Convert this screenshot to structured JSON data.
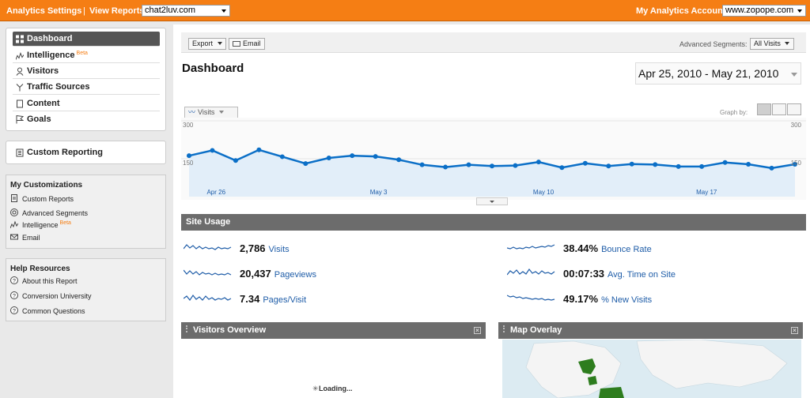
{
  "topbar": {
    "settings_link": "Analytics Settings",
    "view_reports_label": "View Reports:",
    "view_reports_value": "chat2luv.com",
    "accounts_label": "My Analytics Accounts:",
    "accounts_value": "www.zopope.com"
  },
  "nav": {
    "items": [
      {
        "label": "Dashboard",
        "icon": "dashboard-icon"
      },
      {
        "label": "Intelligence",
        "beta": "Beta",
        "icon": "intelligence-icon"
      },
      {
        "label": "Visitors",
        "icon": "person-icon"
      },
      {
        "label": "Traffic Sources",
        "icon": "traffic-icon"
      },
      {
        "label": "Content",
        "icon": "page-icon"
      },
      {
        "label": "Goals",
        "icon": "flag-icon"
      }
    ],
    "custom_reporting": "Custom Reporting"
  },
  "customizations": {
    "title": "My Customizations",
    "items": [
      {
        "label": "Custom Reports",
        "icon": "report-icon"
      },
      {
        "label": "Advanced Segments",
        "icon": "segments-icon"
      },
      {
        "label": "Intelligence",
        "beta": "Beta",
        "icon": "intelligence-icon"
      },
      {
        "label": "Email",
        "icon": "email-icon"
      }
    ]
  },
  "help": {
    "title": "Help Resources",
    "items": [
      {
        "label": "About this Report",
        "icon": "help-icon"
      },
      {
        "label": "Conversion University",
        "icon": "help-icon"
      },
      {
        "label": "Common Questions",
        "icon": "help-icon"
      }
    ]
  },
  "toolbar": {
    "export_label": "Export",
    "email_label": "Email",
    "segments_label": "Advanced Segments:",
    "segments_value": "All Visits"
  },
  "main": {
    "title": "Dashboard",
    "date_range": "Apr 25, 2010 - May 21, 2010",
    "metric_tab": "Visits",
    "graph_by_label": "Graph by:"
  },
  "chart_data": {
    "type": "area",
    "series": [
      {
        "values": [
          162,
          183,
          143,
          185,
          158,
          131,
          153,
          162,
          159,
          146,
          126,
          117,
          126,
          121,
          123,
          137,
          115,
          132,
          121,
          129,
          127,
          119,
          119,
          135,
          128,
          113,
          128
        ]
      }
    ],
    "ylim": [
      0,
      300
    ],
    "y_ticks_left": [
      "300",
      "150"
    ],
    "y_ticks_right": [
      "300",
      "150"
    ],
    "x_tick_labels": [
      "Apr 26",
      "May 3",
      "May 10",
      "May 17"
    ],
    "x_tick_index": [
      1,
      8,
      15,
      22
    ],
    "color": "#0b6fc7",
    "fill": "#e2eef9"
  },
  "site_usage": {
    "title": "Site Usage",
    "metrics": [
      {
        "value": "2,786",
        "label": "Visits"
      },
      {
        "value": "20,437",
        "label": "Pageviews"
      },
      {
        "value": "7.34",
        "label": "Pages/Visit"
      },
      {
        "value": "38.44%",
        "label": "Bounce Rate"
      },
      {
        "value": "00:07:33",
        "label": "Avg. Time on Site"
      },
      {
        "value": "49.17%",
        "label": "% New Visits"
      }
    ]
  },
  "visitors_overview": {
    "title": "Visitors Overview",
    "loading": "Loading..."
  },
  "map_overlay": {
    "title": "Map Overlay"
  }
}
